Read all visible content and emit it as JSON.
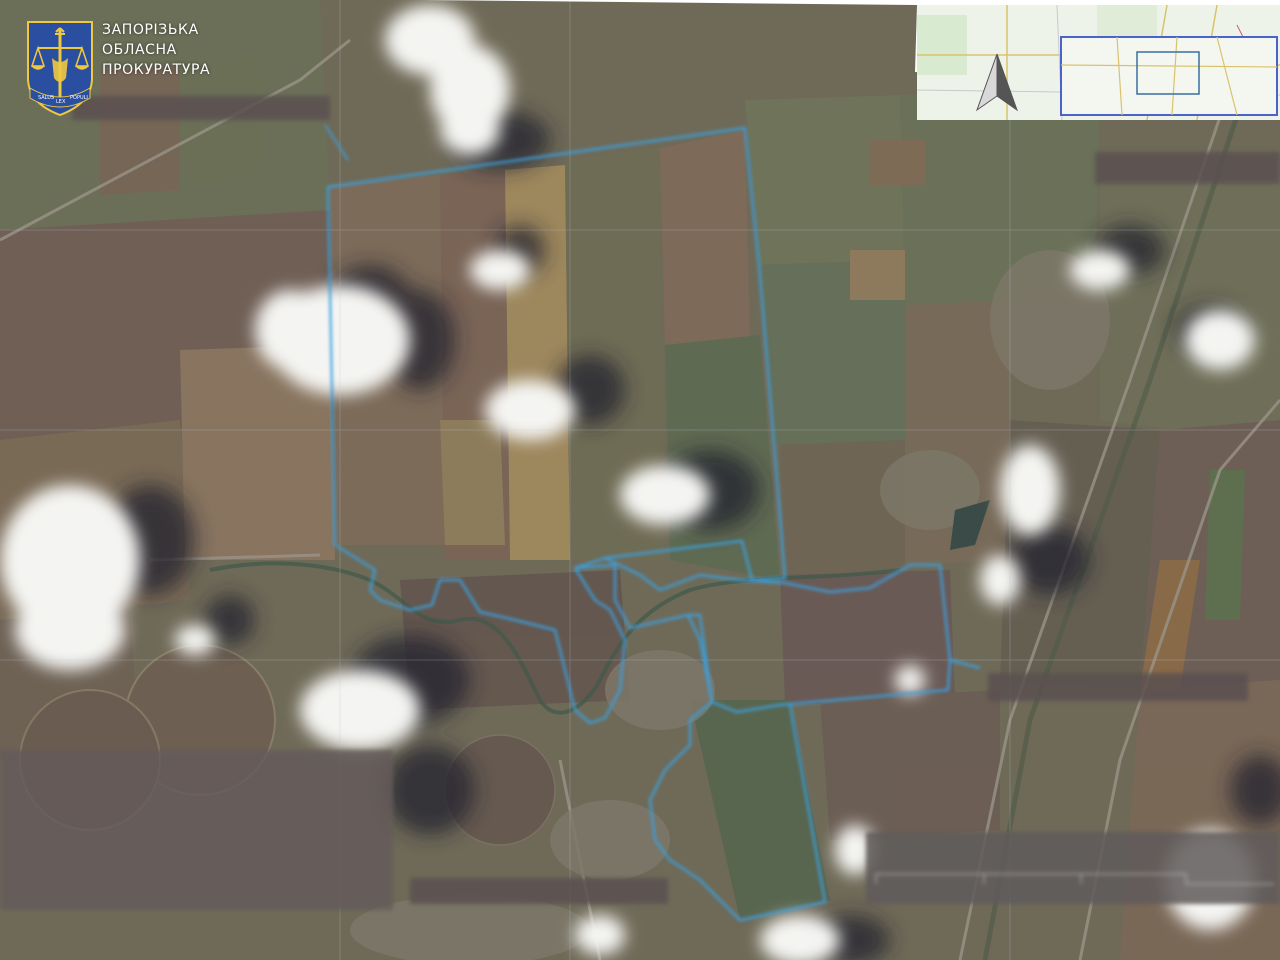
{
  "header": {
    "org_line1": "ЗАПОРІЗЬКА",
    "org_line2": "ОБЛАСНА",
    "org_line3": "ПРОКУРАТУРА"
  },
  "emblem": {
    "icon": "prosecutor-emblem-icon",
    "ribbon_text": [
      "SALUS",
      "LEX",
      "POPULI"
    ]
  },
  "map": {
    "type": "satellite-imagery",
    "boundary_color": "#3aa0e0",
    "compass_icon": "north-arrow-icon",
    "redacted_labels": 7
  },
  "colors": {
    "emblem_blue": "#2a4fa0",
    "emblem_gold": "#f0c840",
    "boundary": "#3aa0e0"
  }
}
